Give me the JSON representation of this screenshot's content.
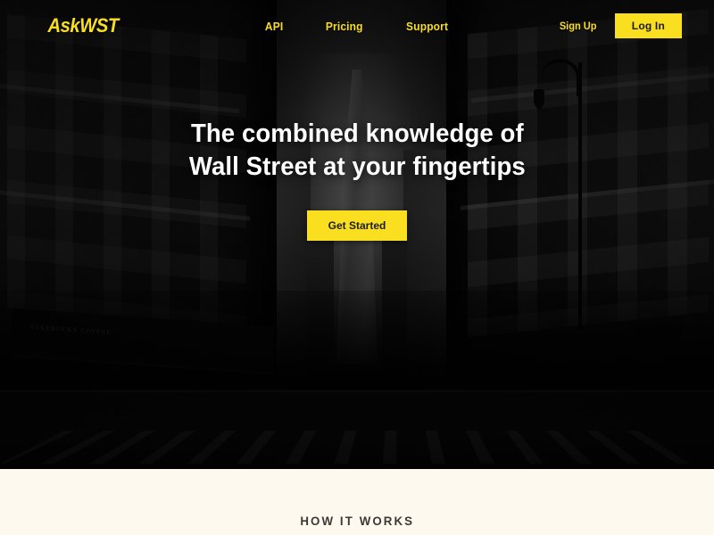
{
  "brand": {
    "logo_text": "AskWST",
    "accent_color": "#F9DF20",
    "hero_overlay_color": "#0a0a0a",
    "section_bg_color": "#FDF9EE"
  },
  "navbar": {
    "links": [
      {
        "label": "API"
      },
      {
        "label": "Pricing"
      },
      {
        "label": "Support"
      }
    ],
    "signup_label": "Sign Up",
    "login_label": "Log In"
  },
  "hero": {
    "headline": "The combined knowledge of\nWall Street at your fingertips",
    "cta_label": "Get Started",
    "background_description": "Grayscale photo of a Manhattan street looking toward One World Trade Center",
    "storefront_sign": "STARBUCKS COFFEE"
  },
  "how_it_works": {
    "title": "HOW IT WORKS"
  }
}
